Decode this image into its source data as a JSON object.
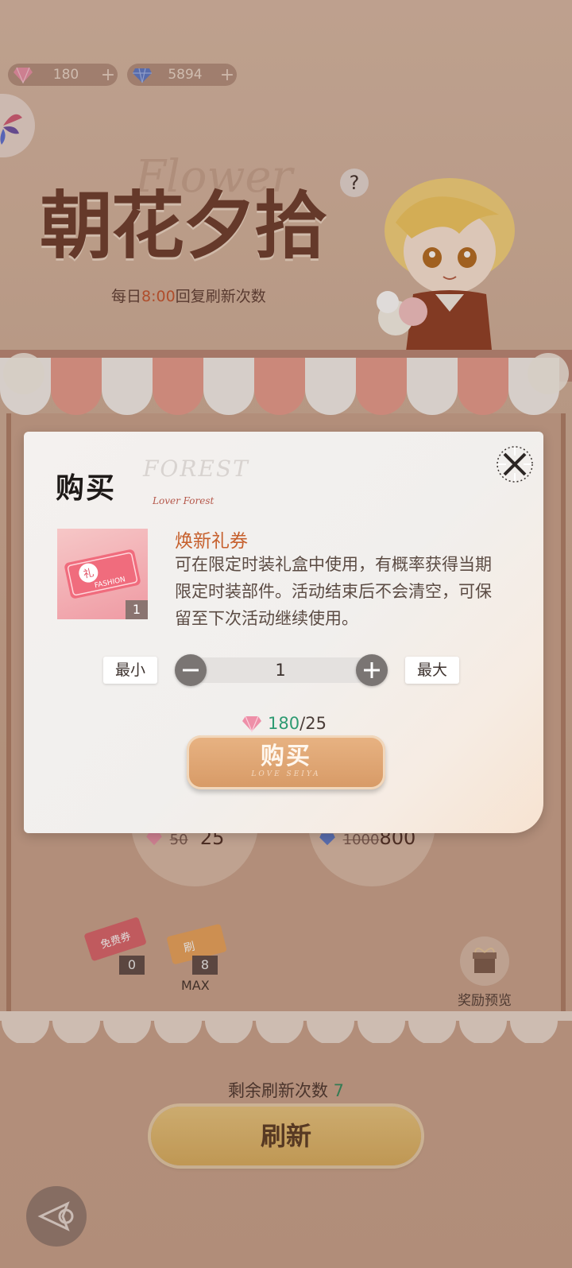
{
  "currency": {
    "gems": {
      "value": "180",
      "plus": "+"
    },
    "diamonds": {
      "value": "5894",
      "plus": "+"
    }
  },
  "event": {
    "title": "朝花夕拾",
    "title_script": "Flower",
    "subtitle_prefix": "每日",
    "subtitle_time": "8:00",
    "subtitle_suffix": "回复刷新次数",
    "help": "?"
  },
  "shop": {
    "items": [
      {
        "old_price": "50",
        "price": "25"
      },
      {
        "old_price": "1000",
        "price": "800"
      }
    ],
    "tickets": [
      {
        "label": "免费券",
        "count": "0"
      },
      {
        "label": "刷",
        "count": "8"
      }
    ],
    "max_label": "MAX",
    "reward_preview": "奖励预览",
    "remaining_label": "剩余刷新次数",
    "remaining_count": "7",
    "refresh_button": "刷新"
  },
  "modal": {
    "title": "购买",
    "deco_text": "FOREST",
    "deco_signature": "Lover Forest",
    "item_name": "焕新礼券",
    "item_description": "可在限定时装礼盒中使用，有概率获得当期限定时装部件。活动结束后不会清空，可保留至下次活动继续使用。",
    "item_quantity_badge": "1",
    "ticket_char": "礼",
    "ticket_word": "FASHION",
    "min_label": "最小",
    "max_label": "最大",
    "quantity": "1",
    "cost_have": "180",
    "cost_sep": "/",
    "cost_need": "25",
    "buy_label": "购买",
    "buy_sub": "LOVE SEIYA"
  },
  "colors": {
    "accent_orange": "#c6602d",
    "have_green": "#2e9a72",
    "button_gold": "#d79a66"
  }
}
